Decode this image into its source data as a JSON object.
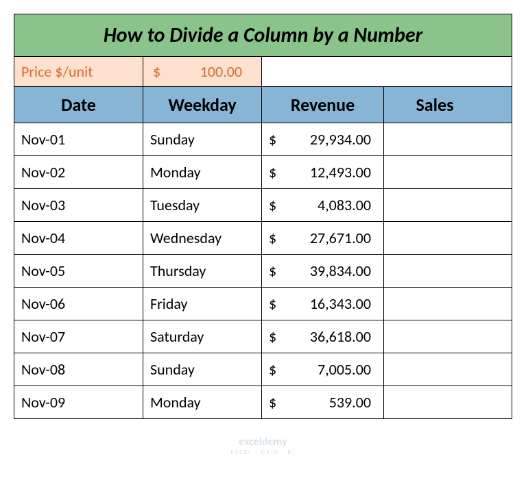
{
  "title": "How to Divide a Column by a Number",
  "price": {
    "label": "Price $/unit",
    "symbol": "$",
    "value": "100.00"
  },
  "headers": {
    "date": "Date",
    "weekday": "Weekday",
    "revenue": "Revenue",
    "sales": "Sales"
  },
  "rows": [
    {
      "date": "Nov-01",
      "weekday": "Sunday",
      "revenue": "29,934.00",
      "sales": ""
    },
    {
      "date": "Nov-02",
      "weekday": "Monday",
      "revenue": "12,493.00",
      "sales": ""
    },
    {
      "date": "Nov-03",
      "weekday": "Tuesday",
      "revenue": "  4,083.00",
      "sales": ""
    },
    {
      "date": "Nov-04",
      "weekday": "Wednesday",
      "revenue": "27,671.00",
      "sales": ""
    },
    {
      "date": "Nov-05",
      "weekday": "Thursday",
      "revenue": "39,834.00",
      "sales": ""
    },
    {
      "date": "Nov-06",
      "weekday": "Friday",
      "revenue": "16,343.00",
      "sales": ""
    },
    {
      "date": "Nov-07",
      "weekday": "Saturday",
      "revenue": "36,618.00",
      "sales": ""
    },
    {
      "date": "Nov-08",
      "weekday": "Sunday",
      "revenue": "  7,005.00",
      "sales": ""
    },
    {
      "date": "Nov-09",
      "weekday": "Monday",
      "revenue": "     539.00",
      "sales": ""
    }
  ],
  "watermark": {
    "brand": "exceldemy",
    "tagline": "EXCEL · DATA · BI"
  }
}
